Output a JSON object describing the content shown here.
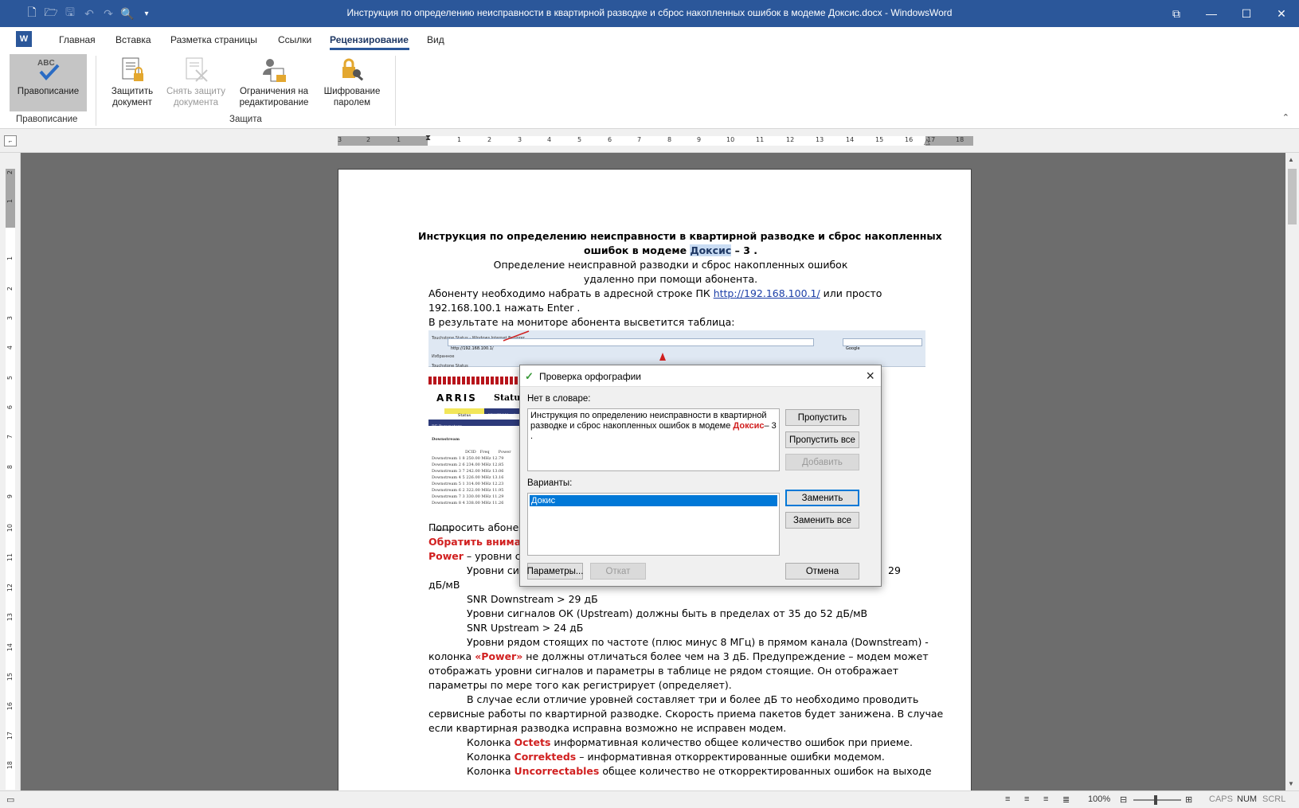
{
  "app": {
    "window_title": "Инструкция по определению неисправности в квартирной разводке и сброс накопленных ошибок в модеме Доксис.docx - WindowsWord",
    "logo_letter": "W"
  },
  "quick_access": {
    "icons": [
      "new-document-icon",
      "open-folder-icon",
      "save-icon",
      "undo-icon",
      "redo-icon",
      "print-preview-icon",
      "customize-icon"
    ]
  },
  "tabs": [
    "Главная",
    "Вставка",
    "Разметка страницы",
    "Ссылки",
    "Рецензирование",
    "Вид"
  ],
  "active_tab": "Рецензирование",
  "ribbon": {
    "spelling": "Правописание",
    "spelling_group": "Правописание",
    "protect_doc": [
      "Защитить",
      "документ"
    ],
    "unprotect_doc": [
      "Снять защиту",
      "документа"
    ],
    "restrict_edit": [
      "Ограничения на",
      "редактирование"
    ],
    "encrypt": [
      "Шифрование",
      "паролем"
    ],
    "protect_group": "Защита"
  },
  "ruler": {
    "labels": [
      "3",
      "2",
      "1",
      "1",
      "2",
      "3",
      "4",
      "5",
      "6",
      "7",
      "8",
      "9",
      "10",
      "11",
      "12",
      "13",
      "14",
      "15",
      "16",
      "17",
      "18"
    ],
    "vlabels": [
      "2",
      "1",
      "1",
      "2",
      "3",
      "4",
      "5",
      "6",
      "7",
      "8",
      "9",
      "10",
      "11",
      "12",
      "13",
      "14",
      "15",
      "16",
      "17",
      "18"
    ]
  },
  "document": {
    "title_line1": "Инструкция по определению неисправности в квартирной разводке и сброс накопленных",
    "title_line2_pre": "ошибок в модеме ",
    "title_line2_hl": "Доксис",
    "title_line2_post": " – 3 .",
    "subtitle1": "Определение неисправной разводки и сброс накопленных ошибок",
    "subtitle2": "удаленно при помощи абонента.",
    "p1_pre": "Абоненту необходимо набрать в адресной строке ПК    ",
    "p1_link": "http://192.168.100.1/",
    "p1_post": "  или  просто",
    "p1_line2": "192.168.100.1  нажать Enter .",
    "p2": "В результате на мониторе абонента высветится таблица:",
    "ask": "Попросить абонен",
    "attention": "Обратить вниман",
    "power_red": "Power",
    "power_rest": " – уровни си",
    "levels_line": "Уровни сиг",
    "levels_end": "29",
    "dbmv": "дБ/мВ",
    "snr_down": "SNR Downstream > 29 дБ",
    "up_levels": "Уровни сигналов ОК (Upstream)  должны быть в пределах от 35 до 52 дБ/мВ",
    "snr_up": "SNR Upstream > 24 дБ",
    "near_1": "Уровни рядом стоящих по частоте (плюс минус 8 МГц)  в прямом канала (Downstream)  -",
    "near_2_pre": "колонка ",
    "near_2_red": "«Power»",
    "near_2_post": " не должны отличаться более чем на 3 дБ. Предупреждение – модем может",
    "near_3": "отображать уровни сигналов и параметры в таблице не рядом стоящие. Он отображает",
    "near_4": "параметры по мере того как регистрирует (определяет).",
    "case_1": "В случае если отличие уровней составляет три и более дБ то необходимо проводить",
    "case_2": "сервисные работы по квартирной разводке. Скорость приема пакетов будет занижена. В случае",
    "case_3": "если квартирная разводка исправна возможно не исправен модем.",
    "octets_pre": "Колонка  ",
    "octets_red": "Octets",
    "octets_post": " информативная количество общее количество ошибок при приеме.",
    "corr_pre": "Колонка ",
    "corr_red": "Correkteds",
    "corr_post": " –  информативная откорректированные ошибки модемом.",
    "unc_pre": "Колонка  ",
    "unc_red": "Uncorrectables",
    "unc_post": " общее количество не откорректированных ошибок на выходе"
  },
  "embedded": {
    "ie_title": "Touchstone Status - Windows Internet Explorer",
    "ie_url": "http://192.168.100.1/",
    "ie_search": "Google",
    "ie_fav": "Избранное",
    "ie_tab": "Touchstone Status",
    "brand": "ARRIS",
    "status": "Status",
    "tab_status": "Status",
    "tab_hwfw": "HW/FW Version",
    "rf": "RF Parameters",
    "downstream": "Downstream",
    "upstream": "Upstream",
    "col_dcid": "DCID",
    "col_freq": "Freq",
    "col_power": "Power",
    "rows": [
      [
        "Downstream 1",
        "8",
        "250.00 MHz",
        "12.79"
      ],
      [
        "Downstream 2",
        "6",
        "234.00 MHz",
        "12.85"
      ],
      [
        "Downstream 3",
        "7",
        "242.00 MHz",
        "13.06"
      ],
      [
        "Downstream 4",
        "5",
        "226.00 MHz",
        "13.16"
      ],
      [
        "Downstream 5",
        "1",
        "314.00 MHz",
        "12.23"
      ],
      [
        "Downstream 6",
        "2",
        "322.00 MHz",
        "11.95"
      ],
      [
        "Downstream 7",
        "3",
        "330.00 MHz",
        "11.29"
      ],
      [
        "Downstream 8",
        "4",
        "338.00 MHz",
        "11.26"
      ]
    ]
  },
  "dialog": {
    "title": "Проверка орфографии",
    "not_in_dict": "Нет в словаре:",
    "text_pre": "Инструкция по определению неисправности в квартирной разводке и сброс накопленных ошибок в модеме ",
    "text_err": "Доксис",
    "text_post": "– 3 .",
    "variants_label": "Варианты:",
    "variants": [
      "Докис"
    ],
    "btn_skip": "Пропустить",
    "btn_skip_all": "Пропустить все",
    "btn_add": "Добавить",
    "btn_replace": "Заменить",
    "btn_replace_all": "Заменить все",
    "btn_options": "Параметры...",
    "btn_undo": "Откат",
    "btn_cancel": "Отмена"
  },
  "statusbar": {
    "zoom": "100%",
    "caps": "CAPS",
    "num": "NUM",
    "scrl": "SCRL"
  }
}
